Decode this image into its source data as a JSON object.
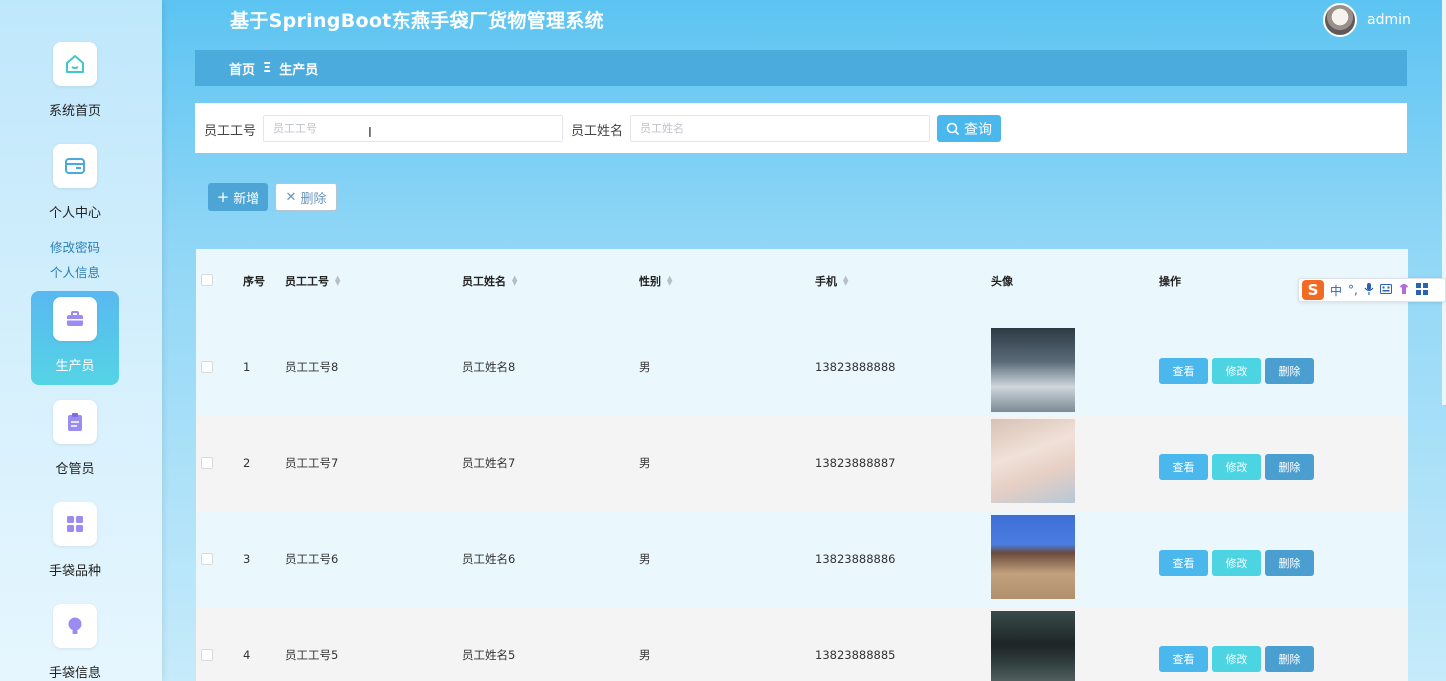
{
  "app": {
    "title": "基于SpringBoot东燕手袋厂货物管理系统",
    "username": "admin"
  },
  "sidebar": {
    "items": [
      {
        "label": "系统首页",
        "icon": "home-icon"
      },
      {
        "label": "个人中心",
        "icon": "wallet-icon"
      },
      {
        "label": "生产员",
        "icon": "briefcase-icon",
        "active": true
      },
      {
        "label": "仓管员",
        "icon": "clipboard-icon"
      },
      {
        "label": "手袋品种",
        "icon": "grid-icon"
      },
      {
        "label": "手袋信息",
        "icon": "bulb-icon"
      }
    ],
    "sub_links": [
      "修改密码",
      "个人信息"
    ]
  },
  "breadcrumb": {
    "home": "首页",
    "separator": "Ξ",
    "current": "生产员"
  },
  "search": {
    "field1_label": "员工工号",
    "field1_placeholder": "员工工号",
    "field2_label": "员工姓名",
    "field2_placeholder": "员工姓名",
    "button_label": "查询"
  },
  "toolbar": {
    "add_label": "新增",
    "delete_label": "删除"
  },
  "table": {
    "columns": [
      "序号",
      "员工工号",
      "员工姓名",
      "性别",
      "手机",
      "头像",
      "操作"
    ],
    "rows": [
      {
        "index": "1",
        "emp_no": "员工工号8",
        "name": "员工姓名8",
        "gender": "男",
        "phone": "13823888888"
      },
      {
        "index": "2",
        "emp_no": "员工工号7",
        "name": "员工姓名7",
        "gender": "男",
        "phone": "13823888887"
      },
      {
        "index": "3",
        "emp_no": "员工工号6",
        "name": "员工姓名6",
        "gender": "男",
        "phone": "13823888886"
      },
      {
        "index": "4",
        "emp_no": "员工工号5",
        "name": "员工姓名5",
        "gender": "男",
        "phone": "13823888885"
      }
    ],
    "actions": {
      "view": "查看",
      "edit": "修改",
      "delete": "删除"
    }
  },
  "ime": {
    "logo": "S",
    "mode": "中",
    "punct": "°,"
  },
  "colors": {
    "accent": "#4ab8ec",
    "header_bar": "#4cabdd",
    "edit": "#4dd4e2",
    "delete": "#4a9fd0"
  }
}
